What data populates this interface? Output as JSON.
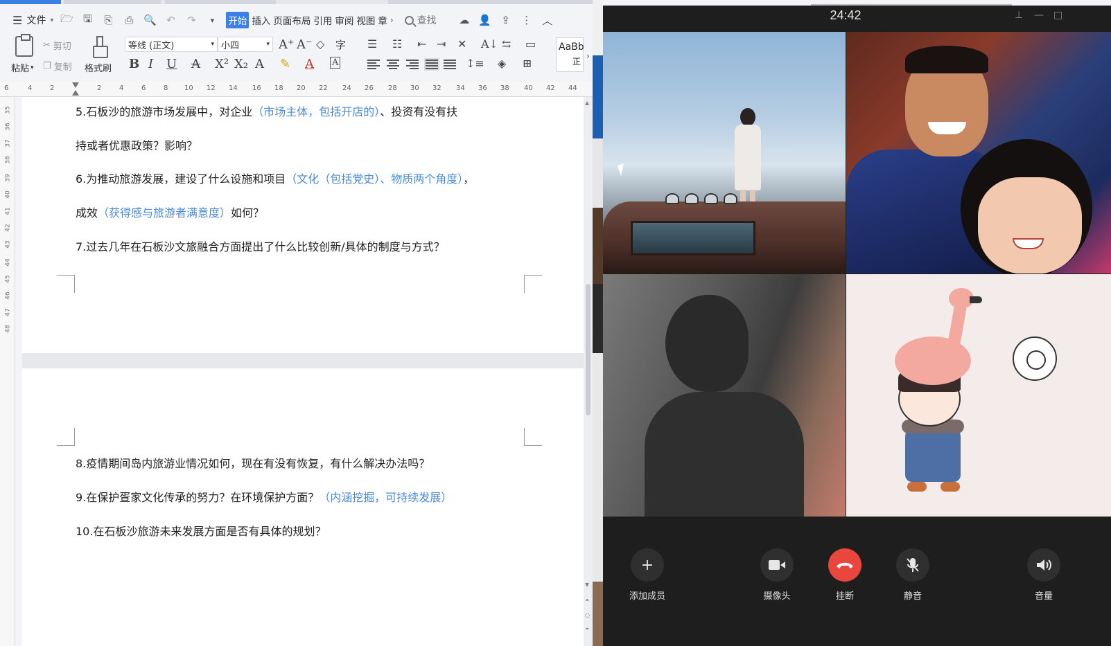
{
  "word": {
    "menu": {
      "file_label": "文件",
      "tabs": [
        "开始",
        "插入",
        "页面布局",
        "引用",
        "审阅",
        "视图",
        "章"
      ],
      "active_tab": "开始",
      "search_label": "查找"
    },
    "ribbon": {
      "paste": "粘贴",
      "cut": "剪切",
      "copy": "复制",
      "format_painter": "格式刷",
      "font_name": "等线 (正文)",
      "font_size": "小四",
      "style_preview": "AaBb",
      "style_name": "正"
    },
    "ruler": {
      "ticks": [
        "6",
        "4",
        "2",
        "2",
        "4",
        "6",
        "8",
        "10",
        "12",
        "14",
        "16",
        "18",
        "20",
        "22",
        "24",
        "26",
        "28",
        "30",
        "32",
        "34",
        "36",
        "38",
        "40",
        "42",
        "44"
      ]
    },
    "line_numbers": [
      "35",
      "36",
      "37",
      "38",
      "39",
      "40",
      "41",
      "42",
      "43",
      "44",
      "45",
      "46",
      "47",
      "48"
    ],
    "document": {
      "page1": [
        {
          "text": "5.石板沙的旅游市场发展中，对企业",
          "blue": "（市场主体，包括开店的）",
          "tail": "、投资有没有扶"
        },
        {
          "text": "持或者优惠政策？影响？",
          "blue": "",
          "tail": ""
        },
        {
          "text": "6.为推动旅游发展，建设了什么设施和项目",
          "blue": "（文化（包括党史）、物质两个角度）",
          "tail": "，"
        },
        {
          "text": "成效",
          "blue": "（获得感与旅游者满意度）",
          "tail": "如何？"
        },
        {
          "text": "7.过去几年在石板沙文旅融合方面提出了什么比较创新/具体的制度与方式？",
          "blue": "",
          "tail": ""
        }
      ],
      "page2": [
        {
          "text": "8.疫情期间岛内旅游业情况如何，现在有没有恢复，有什么解决办法吗？",
          "blue": "",
          "tail": ""
        },
        {
          "text": "9.在保护疍家文化传承的努力？在环境保护方面？",
          "blue": "（内涵挖掘，可持续发展）",
          "tail": ""
        },
        {
          "text": "10.在石板沙旅游未来发展方面是否有具体的规划？",
          "blue": "",
          "tail": ""
        }
      ]
    }
  },
  "call": {
    "timer": "24:42",
    "controls": {
      "add_member": "添加成员",
      "camera": "摄像头",
      "hangup": "挂断",
      "mute": "静音",
      "volume": "音量"
    },
    "colors": {
      "hangup": "#e9463d",
      "button": "#2f2f2f",
      "background": "#1e1e1e",
      "accent": "#3c7fe6",
      "annotation_blue": "#4a8ad6"
    }
  }
}
